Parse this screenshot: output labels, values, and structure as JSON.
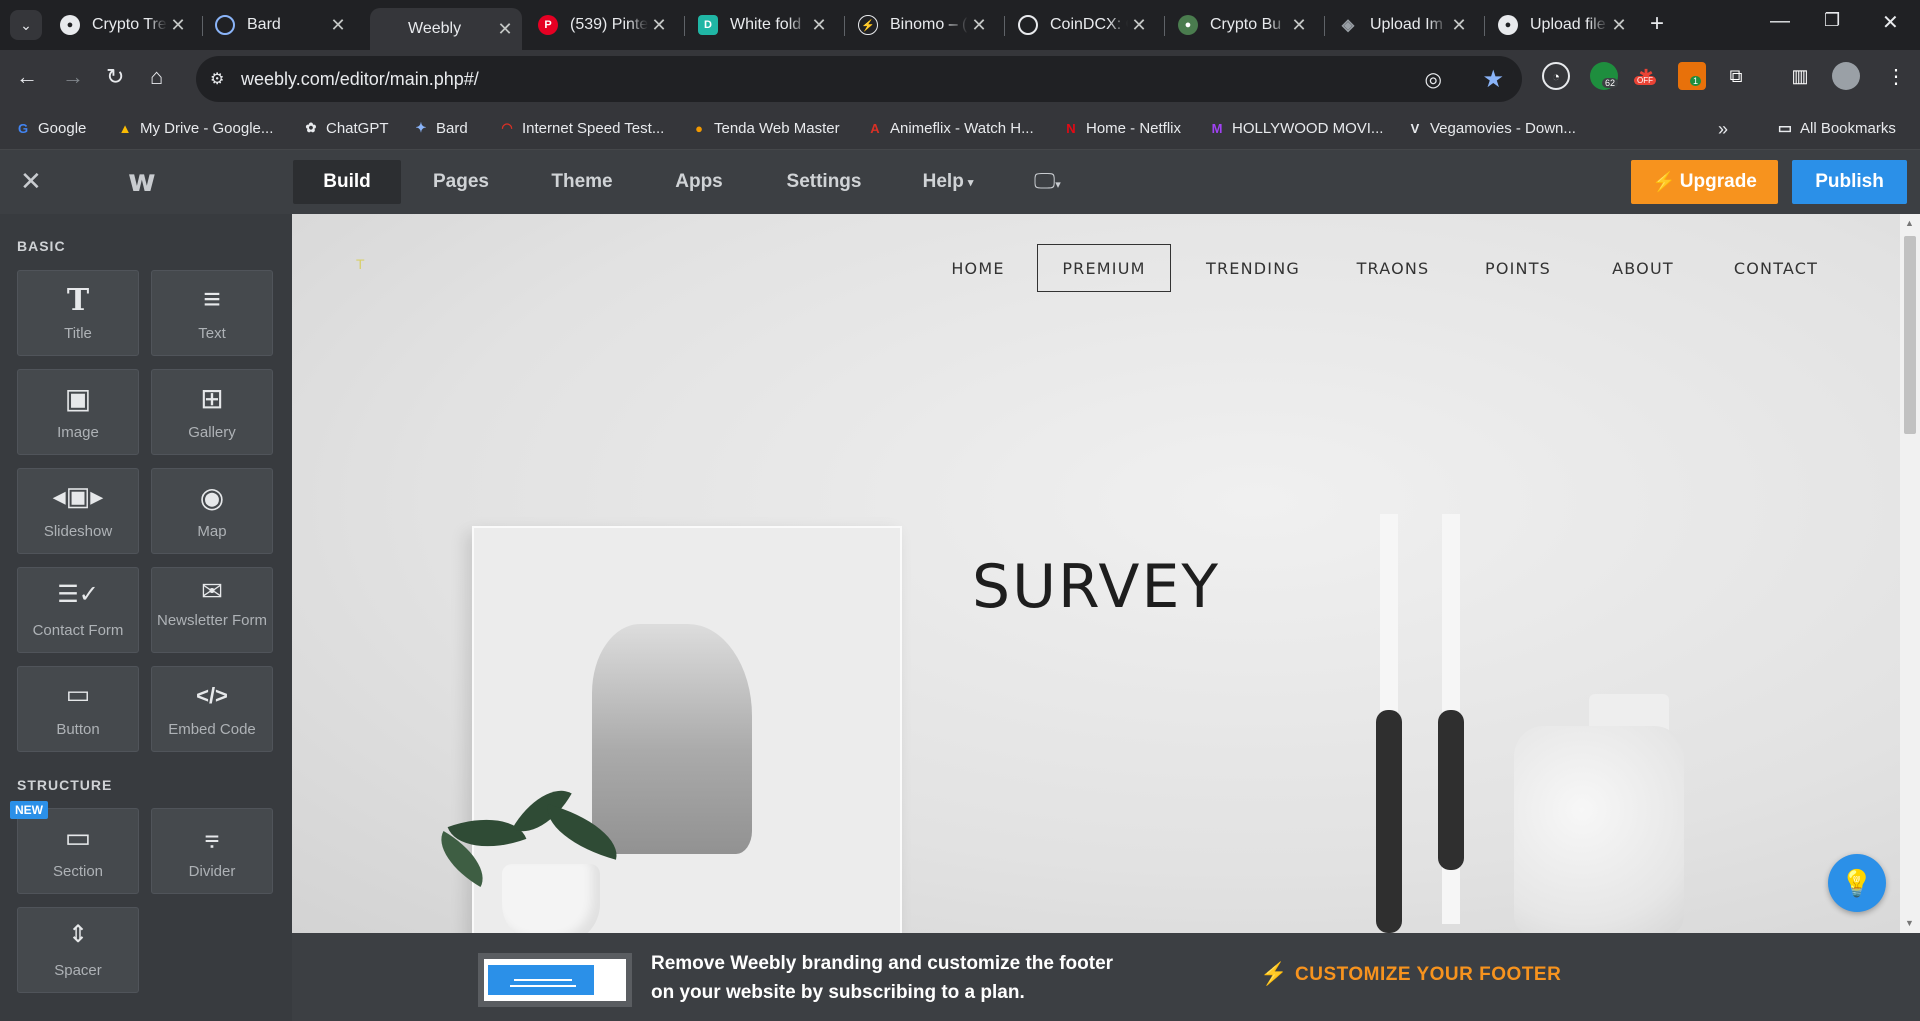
{
  "browser": {
    "tabs": [
      {
        "title": "Crypto Tre",
        "icon": "github-icon",
        "color": "#e8eaed"
      },
      {
        "title": "Bard",
        "icon": "bard-icon",
        "color": "#8ab4f8"
      },
      {
        "title": "Weebly",
        "icon": "",
        "color": "",
        "active": true
      },
      {
        "title": "(539) Pinte",
        "icon": "pinterest-icon",
        "color": "#e60023"
      },
      {
        "title": "White fold",
        "icon": "doc-icon",
        "color": "#20b6a5"
      },
      {
        "title": "Binomo – (",
        "icon": "lightning-icon",
        "color": "#f4c20d"
      },
      {
        "title": "CoinDCX: C",
        "icon": "coin-icon",
        "color": "#e8eaed"
      },
      {
        "title": "Crypto Bu",
        "icon": "github-icon",
        "color": "#7bc47f"
      },
      {
        "title": "Upload Im",
        "icon": "layers-icon",
        "color": "#9aa0a6"
      },
      {
        "title": "Upload file",
        "icon": "github-icon",
        "color": "#e8eaed"
      }
    ],
    "url": "weebly.com/editor/main.php#/",
    "extension_badges": {
      "ext1": "62",
      "ext2": "OFF",
      "ext3": "1"
    },
    "bookmarks": [
      {
        "label": "Google",
        "icon": "google-icon",
        "color": "#4285f4"
      },
      {
        "label": "My Drive - Google...",
        "icon": "drive-icon",
        "color": "#fbbc04"
      },
      {
        "label": "ChatGPT",
        "icon": "chatgpt-icon",
        "color": "#e8eaed"
      },
      {
        "label": "Bard",
        "icon": "bard-icon",
        "color": "#8ab4f8"
      },
      {
        "label": "Internet Speed Test...",
        "icon": "speed-icon",
        "color": "#d93025"
      },
      {
        "label": "Tenda Web Master",
        "icon": "tenda-icon",
        "color": "#f29900"
      },
      {
        "label": "Animeflix - Watch H...",
        "icon": "animeflix-icon",
        "color": "#d93025"
      },
      {
        "label": "Home - Netflix",
        "icon": "netflix-icon",
        "color": "#e50914"
      },
      {
        "label": "HOLLYWOOD MOVI...",
        "icon": "movie-icon",
        "color": "#a142f4"
      },
      {
        "label": "Vegamovies - Down...",
        "icon": "vega-icon",
        "color": "#e8eaed"
      }
    ],
    "all_bookmarks": "All Bookmarks"
  },
  "editor": {
    "nav": [
      "Build",
      "Pages",
      "Theme",
      "Apps",
      "Settings",
      "Help"
    ],
    "upgrade": "Upgrade",
    "publish": "Publish",
    "sidebar": {
      "basic_label": "BASIC",
      "structure_label": "STRUCTURE",
      "new_badge": "NEW",
      "basic": [
        {
          "label": "Title",
          "icon": "title-icon"
        },
        {
          "label": "Text",
          "icon": "text-icon"
        },
        {
          "label": "Image",
          "icon": "image-icon"
        },
        {
          "label": "Gallery",
          "icon": "gallery-icon"
        },
        {
          "label": "Slideshow",
          "icon": "slideshow-icon"
        },
        {
          "label": "Map",
          "icon": "map-icon"
        },
        {
          "label": "Contact Form",
          "icon": "contact-form-icon"
        },
        {
          "label": "Newsletter Form",
          "icon": "newsletter-icon"
        },
        {
          "label": "Button",
          "icon": "button-icon"
        },
        {
          "label": "Embed Code",
          "icon": "embed-icon"
        }
      ],
      "structure": [
        {
          "label": "Section",
          "icon": "section-icon"
        },
        {
          "label": "Divider",
          "icon": "divider-icon"
        },
        {
          "label": "Spacer",
          "icon": "spacer-icon"
        }
      ]
    },
    "site": {
      "logo_mark": "T",
      "nav": [
        "HOME",
        "PREMIUM",
        "TRENDING",
        "TRAONS",
        "POINTS",
        "ABOUT",
        "CONTACT"
      ],
      "active_nav": "PREMIUM",
      "hero_title": "SURVEY"
    },
    "footer_promo": {
      "text": "Remove Weebly branding and customize the footer on your website by subscribing to a plan.",
      "cta": "CUSTOMIZE YOUR FOOTER"
    },
    "colors": {
      "upgrade": "#f7931e",
      "publish": "#2b90e8"
    }
  }
}
